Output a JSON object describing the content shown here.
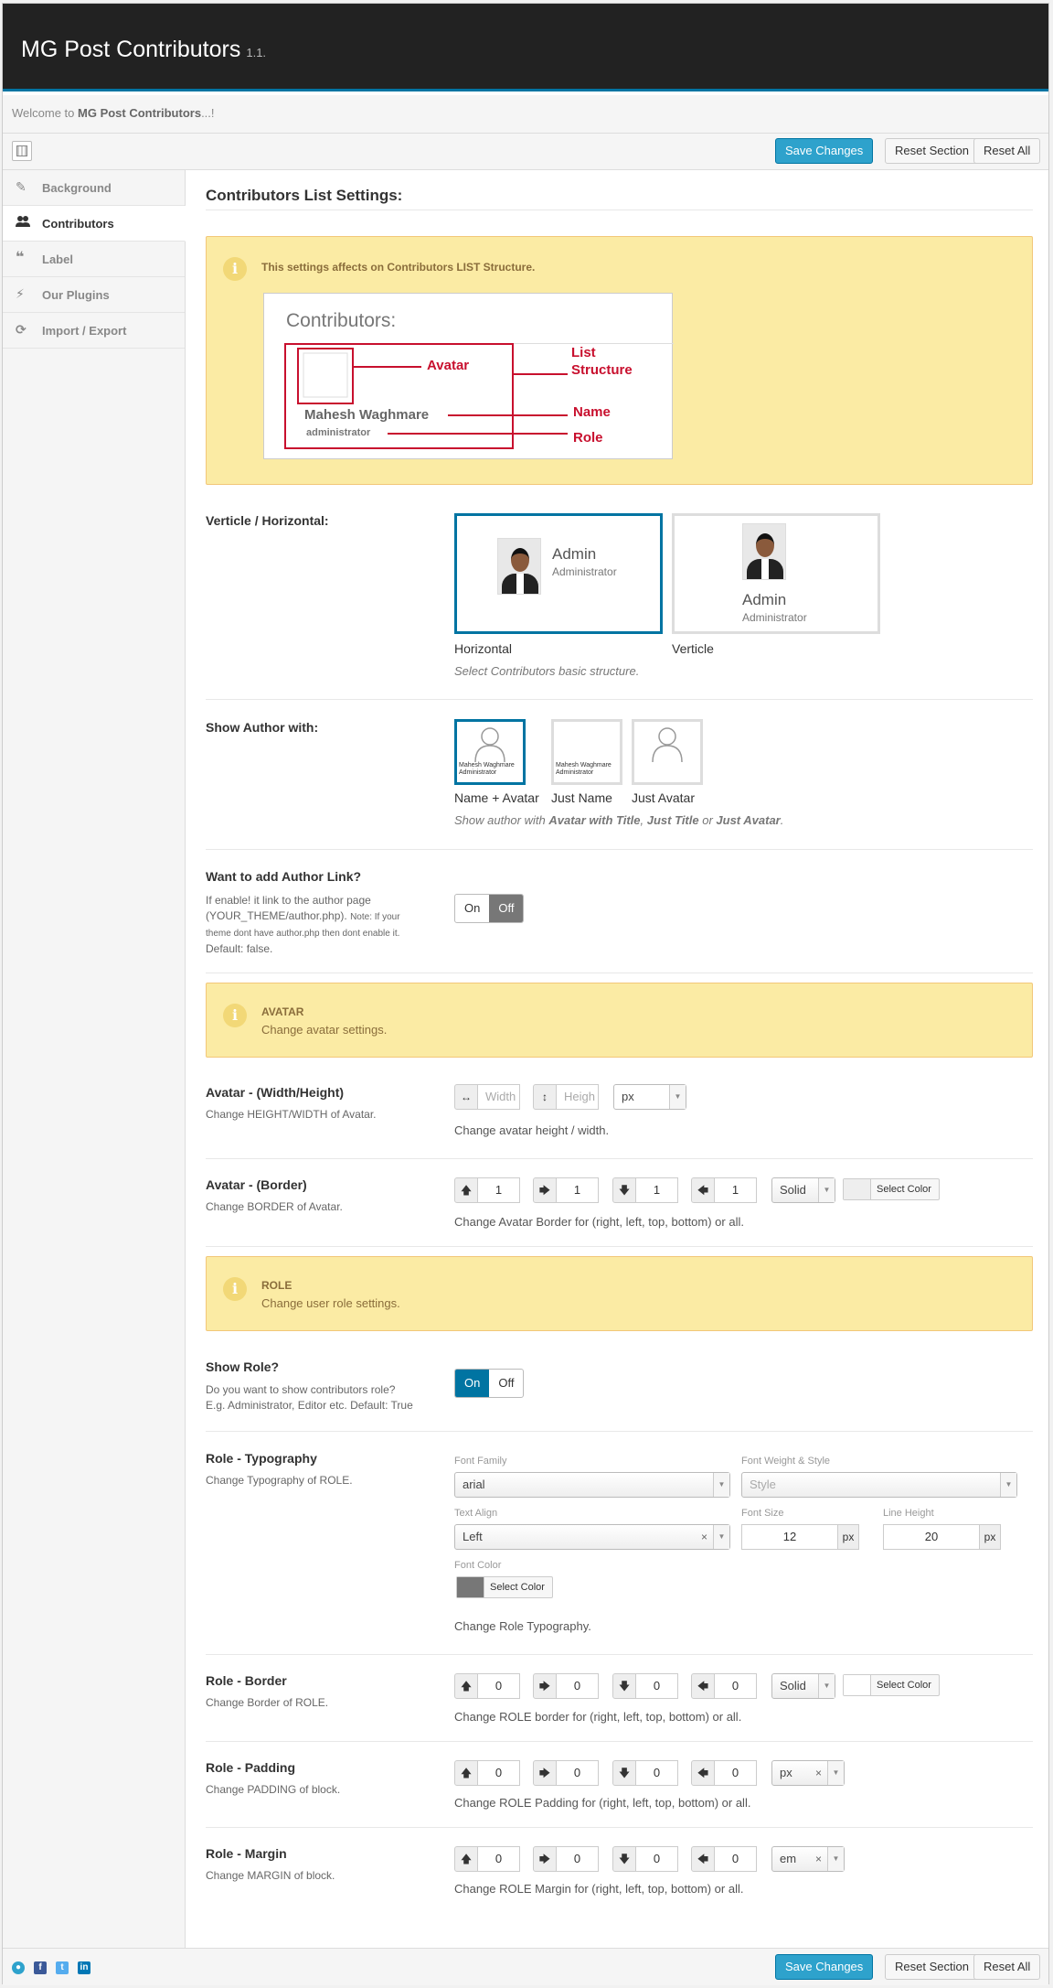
{
  "header": {
    "title": "MG Post Contributors",
    "version": "1.1."
  },
  "welcome": {
    "prefix": "Welcome to ",
    "name": "MG Post Contributors",
    "suffix": "...!"
  },
  "toolbar": {
    "save_label": "Save Changes",
    "reset_section_label": "Reset Section",
    "reset_all_label": "Reset All"
  },
  "sidebar": {
    "items": [
      {
        "label": "Background",
        "icon": "pin-icon"
      },
      {
        "label": "Contributors",
        "icon": "users-icon"
      },
      {
        "label": "Label",
        "icon": "quote-icon"
      },
      {
        "label": "Our Plugins",
        "icon": "plug-icon"
      },
      {
        "label": "Import / Export",
        "icon": "refresh-icon"
      }
    ]
  },
  "main": {
    "title": "Contributors List Settings:",
    "notice_list": {
      "text": "This settings affects on Contributors LIST Structure.",
      "diagram": {
        "heading": "Contributors:",
        "name": "Mahesh Waghmare",
        "role": "administrator",
        "lbl_avatar": "Avatar",
        "lbl_list": "List",
        "lbl_structure": "Structure",
        "lbl_name": "Name",
        "lbl_role": "Role"
      }
    },
    "orientation": {
      "title": "Verticle / Horizontal:",
      "options": [
        {
          "label": "Horizontal",
          "name": "Admin",
          "role": "Administrator"
        },
        {
          "label": "Verticle",
          "name": "Admin",
          "role": "Administrator"
        }
      ],
      "help": "Select Contributors basic structure."
    },
    "show_author": {
      "title": "Show Author with:",
      "options": [
        {
          "label": "Name + Avatar",
          "cap1": "Mahesh Waghmare",
          "cap2": "Administrator"
        },
        {
          "label": "Just Name",
          "cap1": "Mahesh Waghmare",
          "cap2": "Administrator"
        },
        {
          "label": "Just Avatar"
        }
      ],
      "help_prefix": "Show author with ",
      "help_a": "Avatar with Title",
      "help_b": "Just Title",
      "help_or": " or ",
      "help_c": "Just Avatar"
    },
    "author_link": {
      "title": "Want to add Author Link?",
      "desc1": "If enable! it link to the author page",
      "desc2": "(YOUR_THEME/author.php).",
      "note": "Note: If your theme dont have author.php then dont enable it.",
      "default": "Default: false.",
      "on": "On",
      "off": "Off"
    },
    "notice_avatar": {
      "title": "AVATAR",
      "desc": "Change avatar settings."
    },
    "avatar_size": {
      "title": "Avatar - (Width/Height)",
      "desc": "Change HEIGHT/WIDTH of Avatar.",
      "width_placeholder": "Width",
      "height_placeholder": "Heigh",
      "unit": "px",
      "help": "Change avatar height / width."
    },
    "avatar_border": {
      "title": "Avatar - (Border)",
      "desc": "Change BORDER of Avatar.",
      "values": [
        "1",
        "1",
        "1",
        "1"
      ],
      "style": "Solid",
      "color_label": "Select Color",
      "help": "Change Avatar Border for (right, left, top, bottom) or all."
    },
    "notice_role": {
      "title": "ROLE",
      "desc": "Change user role settings."
    },
    "show_role": {
      "title": "Show Role?",
      "desc1": "Do you want to show contributors role?",
      "desc2": "E.g. Administrator, Editor etc. Default: True",
      "on": "On",
      "off": "Off"
    },
    "role_typo": {
      "title": "Role - Typography",
      "desc": "Change Typography of ROLE.",
      "font_family_label": "Font Family",
      "font_family": "arial",
      "font_weight_label": "Font Weight & Style",
      "font_weight_placeholder": "Style",
      "text_align_label": "Text Align",
      "text_align": "Left",
      "font_size_label": "Font Size",
      "font_size": "12",
      "line_height_label": "Line Height",
      "line_height": "20",
      "unit": "px",
      "font_color_label": "Font Color",
      "color_label": "Select Color",
      "help": "Change Role Typography."
    },
    "role_border": {
      "title": "Role - Border",
      "desc": "Change Border of ROLE.",
      "values": [
        "0",
        "0",
        "0",
        "0"
      ],
      "style": "Solid",
      "color_label": "Select Color",
      "help": "Change ROLE border for (right, left, top, bottom) or all."
    },
    "role_padding": {
      "title": "Role - Padding",
      "desc": "Change PADDING of block.",
      "values": [
        "0",
        "0",
        "0",
        "0"
      ],
      "unit": "px",
      "help": "Change ROLE Padding for (right, left, top, bottom) or all."
    },
    "role_margin": {
      "title": "Role - Margin",
      "desc": "Change MARGIN of block.",
      "values": [
        "0",
        "0",
        "0",
        "0"
      ],
      "unit": "em",
      "help": "Change ROLE Margin for (right, left, top, bottom) or all."
    }
  },
  "footer": {
    "social": [
      "github-icon",
      "facebook-icon",
      "twitter-icon",
      "linkedin-icon"
    ]
  },
  "colors": {
    "accent": "#0074a2",
    "primary_button": "#2ea2cc",
    "notice_bg": "#fbeba4",
    "diagram_red": "#c8102e"
  }
}
